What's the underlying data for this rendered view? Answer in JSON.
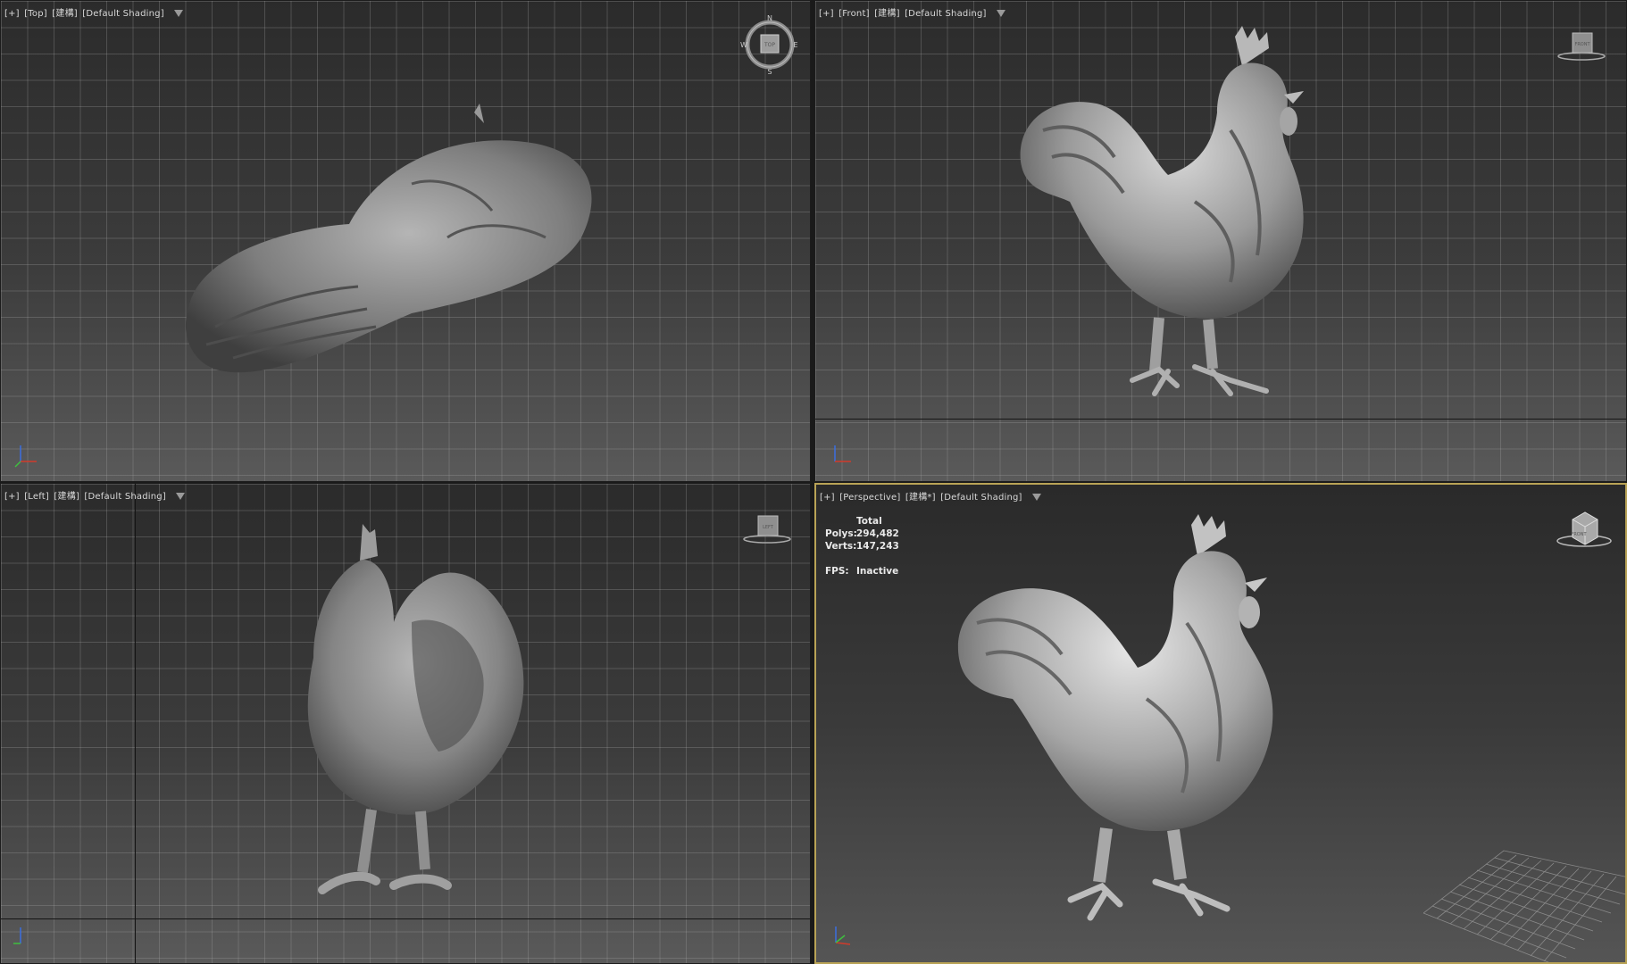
{
  "viewports": {
    "top": {
      "plus": "[+]",
      "view": "[Top]",
      "mode": "[建構]",
      "shading": "[Default Shading]"
    },
    "front": {
      "plus": "[+]",
      "view": "[Front]",
      "mode": "[建構]",
      "shading": "[Default Shading]"
    },
    "left": {
      "plus": "[+]",
      "view": "[Left]",
      "mode": "[建構]",
      "shading": "[Default Shading]"
    },
    "perspective": {
      "plus": "[+]",
      "view": "[Perspective]",
      "mode": "[建構*]",
      "shading": "[Default Shading]"
    }
  },
  "compass": {
    "n": "N",
    "s": "S",
    "e": "E",
    "w": "W",
    "cube_label": "TOP"
  },
  "navcubes": {
    "front": "FRONT",
    "left": "LEFT",
    "perspective": "FRONT"
  },
  "stats": {
    "header": "Total",
    "polys_label": "Polys:",
    "polys_value": "294,482",
    "verts_label": "Verts:",
    "verts_value": "147,243",
    "fps_label": "FPS:",
    "fps_value": "Inactive"
  },
  "colors": {
    "active_border": "#b9a356",
    "axis_x": "#d23b2b",
    "axis_y": "#3fbf3f",
    "axis_z": "#3b6fe0"
  },
  "icons": [
    "filter-icon",
    "compass-icon",
    "viewcube-icon",
    "axis-tripod-icon"
  ]
}
